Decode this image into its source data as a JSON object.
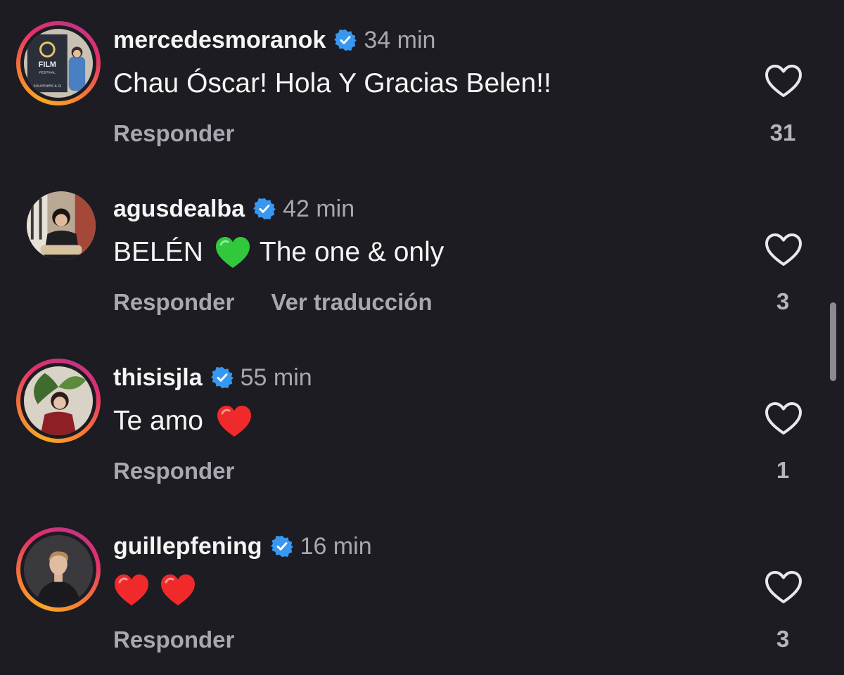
{
  "comments": [
    {
      "username": "mercedesmoranok",
      "time": "34 min",
      "text_parts": [
        "Chau Óscar! Hola Y Gracias Belen!!"
      ],
      "reply_label": "Responder",
      "translate_label": "",
      "likes": "31"
    },
    {
      "username": "agusdealba",
      "time": "42 min",
      "text_parts": [
        "BELÉN",
        "The one & only"
      ],
      "emoji": "green-heart",
      "reply_label": "Responder",
      "translate_label": "Ver traducción",
      "likes": "3"
    },
    {
      "username": "thisisjla",
      "time": "55 min",
      "text_parts": [
        "Te amo"
      ],
      "emoji": "red-heart",
      "reply_label": "Responder",
      "translate_label": "",
      "likes": "1"
    },
    {
      "username": "guillepfening",
      "time": "16 min",
      "text_parts": [],
      "emoji": "red-heart x2",
      "reply_label": "Responder",
      "translate_label": "",
      "likes": "3"
    }
  ],
  "colors": {
    "background": "#1c1c22",
    "verified": "#3897f0",
    "muted": "#a8a8b0"
  },
  "avatar_photo_texts": [
    "FILM",
    "FESTIVAL",
    "SOUVENIRS & GI"
  ],
  "icons": [
    "verified-badge-icon",
    "heart-outline-icon",
    "green-heart-emoji",
    "red-heart-emoji"
  ]
}
